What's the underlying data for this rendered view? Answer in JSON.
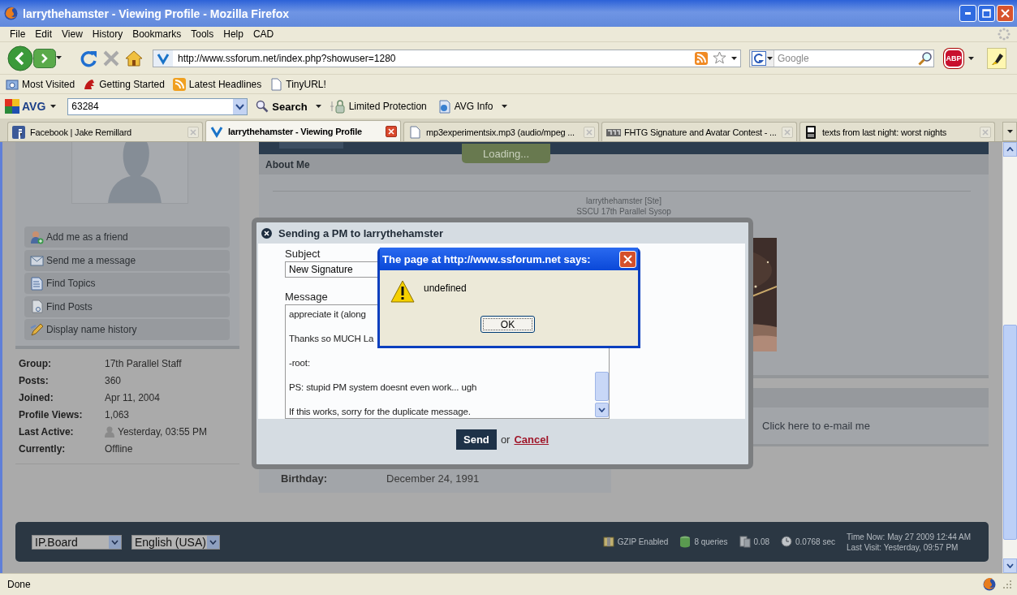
{
  "window": {
    "title": "larrythehamster - Viewing Profile - Mozilla Firefox"
  },
  "menu": [
    "File",
    "Edit",
    "View",
    "History",
    "Bookmarks",
    "Tools",
    "Help",
    "CAD"
  ],
  "address_bar": {
    "url": "http://www.ssforum.net/index.php?showuser=1280"
  },
  "search": {
    "placeholder": "Google"
  },
  "adblock": {
    "label": "ABP"
  },
  "bookmarks": [
    {
      "label": "Most Visited",
      "kind": "folder"
    },
    {
      "label": "Getting Started",
      "kind": "creature"
    },
    {
      "label": "Latest Headlines",
      "kind": "feed"
    },
    {
      "label": "TinyURL!",
      "kind": "page"
    }
  ],
  "avg_toolbar": {
    "logo": "AVG",
    "query": "63284",
    "search": "Search",
    "protection": "Limited Protection",
    "info": "AVG Info"
  },
  "tabs": [
    {
      "title": "Facebook | Jake Remillard",
      "kind": "square",
      "selected": false
    },
    {
      "title": "larrythehamster - Viewing Profile",
      "kind": "site",
      "selected": true
    },
    {
      "title": "mp3experimentsix.mp3 (audio/mpeg ...",
      "kind": "page",
      "selected": false
    },
    {
      "title": "FHTG Signature and Avatar Contest - ...",
      "kind": "banner",
      "selected": false
    },
    {
      "title": "texts from last night: worst nights",
      "kind": "phone",
      "selected": false
    }
  ],
  "profile_actions": [
    {
      "label": "Add me as a friend",
      "kind": "friend"
    },
    {
      "label": "Send me a message",
      "kind": "message"
    },
    {
      "label": "Find Topics",
      "kind": "topics"
    },
    {
      "label": "Find Posts",
      "kind": "posts"
    },
    {
      "label": "Display name history",
      "kind": "history"
    }
  ],
  "profile_info": [
    {
      "label": "Group:",
      "value": "17th Parallel Staff"
    },
    {
      "label": "Posts:",
      "value": "360"
    },
    {
      "label": "Joined:",
      "value": "Apr 11, 2004"
    },
    {
      "label": "Profile Views:",
      "value": "1,063"
    },
    {
      "label": "Last Active:",
      "value": "Yesterday, 03:55 PM",
      "icon": true
    },
    {
      "label": "Currently:",
      "value": "Offline"
    }
  ],
  "about": {
    "title": "About Me",
    "lines": [
      "larrythehamster [Ste]",
      "SSCU 17th Parallel Sysop"
    ]
  },
  "contact": {
    "email_link": "Click here to e-mail me"
  },
  "birthday": {
    "label": "Birthday:",
    "value": "December 24, 1991"
  },
  "loading": "Loading...",
  "pm_dialog": {
    "title": "Sending a PM to larrythehamster",
    "subject_label": "Subject",
    "subject": "New Signature",
    "message_label": "Message",
    "message_lines": [
      "appreciate it (along",
      "Thanks so MUCH La",
      "-root:",
      "PS: stupid PM system doesnt even work... ugh",
      "If this works, sorry for the duplicate message."
    ],
    "send": "Send",
    "or": "or",
    "cancel": "Cancel"
  },
  "alert": {
    "title": "The page at http://www.ssforum.net says:",
    "message": "undefined",
    "ok": "OK"
  },
  "footer": {
    "skin": "IP.Board",
    "language": "English (USA)",
    "stats": [
      {
        "text": "GZIP Enabled",
        "kind": "archive"
      },
      {
        "text": "8 queries",
        "kind": "database"
      },
      {
        "text": "0.08",
        "kind": "server"
      },
      {
        "text": "0.0768 sec",
        "kind": "clock"
      }
    ],
    "time_now": "Time Now: May 27 2009 12:44 AM",
    "last_visit": "Last Visit: Yesterday, 09:57 PM"
  },
  "status_bar": {
    "text": "Done"
  }
}
